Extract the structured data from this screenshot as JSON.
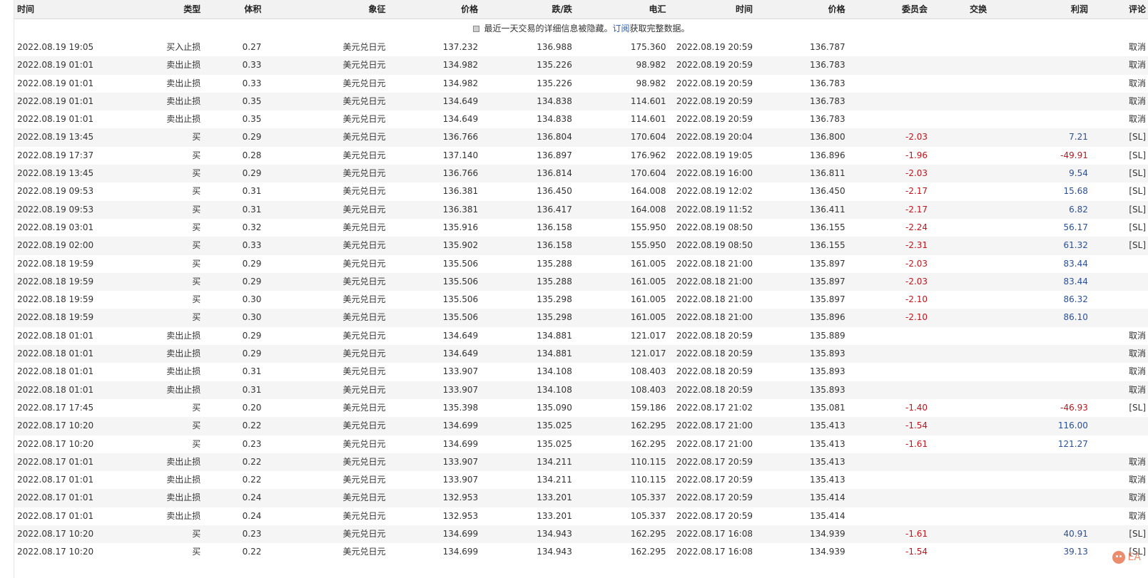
{
  "headers": {
    "open_time": "时间",
    "type": "类型",
    "volume": "体积",
    "symbol": "象征",
    "open_price": "价格",
    "sl": "跌/跌",
    "tp": "电汇",
    "close_time": "时间",
    "close_price": "价格",
    "commission": "委员会",
    "swap": "交换",
    "profit": "利润",
    "comment": "评论"
  },
  "notice": {
    "text_before": "最近一天交易的详细信息被隐藏。",
    "link": "订阅",
    "text_after": "获取完整数据。"
  },
  "watermark": "EA",
  "colors": {
    "negative": "#c0141c",
    "positive": "#2a4f9a",
    "header_bg": "#f2f2f2",
    "stripe_bg": "#f5f5f5"
  },
  "rows": [
    {
      "open_time": "2022.08.19 19:05",
      "type": "买入止损",
      "volume": "0.27",
      "symbol": "美元兑日元",
      "open_price": "137.232",
      "sl": "136.988",
      "tp": "175.360",
      "close_time": "2022.08.19 20:59",
      "close_price": "136.787",
      "commission": "",
      "commission_sign": "",
      "swap": "",
      "profit": "",
      "profit_sign": "",
      "comment": "取消"
    },
    {
      "open_time": "2022.08.19 01:01",
      "type": "卖出止损",
      "volume": "0.33",
      "symbol": "美元兑日元",
      "open_price": "134.982",
      "sl": "135.226",
      "tp": "98.982",
      "close_time": "2022.08.19 20:59",
      "close_price": "136.783",
      "commission": "",
      "commission_sign": "",
      "swap": "",
      "profit": "",
      "profit_sign": "",
      "comment": "取消"
    },
    {
      "open_time": "2022.08.19 01:01",
      "type": "卖出止损",
      "volume": "0.33",
      "symbol": "美元兑日元",
      "open_price": "134.982",
      "sl": "135.226",
      "tp": "98.982",
      "close_time": "2022.08.19 20:59",
      "close_price": "136.783",
      "commission": "",
      "commission_sign": "",
      "swap": "",
      "profit": "",
      "profit_sign": "",
      "comment": "取消"
    },
    {
      "open_time": "2022.08.19 01:01",
      "type": "卖出止损",
      "volume": "0.35",
      "symbol": "美元兑日元",
      "open_price": "134.649",
      "sl": "134.838",
      "tp": "114.601",
      "close_time": "2022.08.19 20:59",
      "close_price": "136.783",
      "commission": "",
      "commission_sign": "",
      "swap": "",
      "profit": "",
      "profit_sign": "",
      "comment": "取消"
    },
    {
      "open_time": "2022.08.19 01:01",
      "type": "卖出止损",
      "volume": "0.35",
      "symbol": "美元兑日元",
      "open_price": "134.649",
      "sl": "134.838",
      "tp": "114.601",
      "close_time": "2022.08.19 20:59",
      "close_price": "136.783",
      "commission": "",
      "commission_sign": "",
      "swap": "",
      "profit": "",
      "profit_sign": "",
      "comment": "取消"
    },
    {
      "open_time": "2022.08.19 13:45",
      "type": "买",
      "volume": "0.29",
      "symbol": "美元兑日元",
      "open_price": "136.766",
      "sl": "136.804",
      "tp": "170.604",
      "close_time": "2022.08.19 20:04",
      "close_price": "136.800",
      "commission": "-2.03",
      "commission_sign": "neg",
      "swap": "",
      "profit": "7.21",
      "profit_sign": "pos",
      "comment": "[SL]"
    },
    {
      "open_time": "2022.08.19 17:37",
      "type": "买",
      "volume": "0.28",
      "symbol": "美元兑日元",
      "open_price": "137.140",
      "sl": "136.897",
      "tp": "176.962",
      "close_time": "2022.08.19 19:05",
      "close_price": "136.896",
      "commission": "-1.96",
      "commission_sign": "neg",
      "swap": "",
      "profit": "-49.91",
      "profit_sign": "neg",
      "comment": "[SL]"
    },
    {
      "open_time": "2022.08.19 13:45",
      "type": "买",
      "volume": "0.29",
      "symbol": "美元兑日元",
      "open_price": "136.766",
      "sl": "136.814",
      "tp": "170.604",
      "close_time": "2022.08.19 16:00",
      "close_price": "136.811",
      "commission": "-2.03",
      "commission_sign": "neg",
      "swap": "",
      "profit": "9.54",
      "profit_sign": "pos",
      "comment": "[SL]"
    },
    {
      "open_time": "2022.08.19 09:53",
      "type": "买",
      "volume": "0.31",
      "symbol": "美元兑日元",
      "open_price": "136.381",
      "sl": "136.450",
      "tp": "164.008",
      "close_time": "2022.08.19 12:02",
      "close_price": "136.450",
      "commission": "-2.17",
      "commission_sign": "neg",
      "swap": "",
      "profit": "15.68",
      "profit_sign": "pos",
      "comment": "[SL]"
    },
    {
      "open_time": "2022.08.19 09:53",
      "type": "买",
      "volume": "0.31",
      "symbol": "美元兑日元",
      "open_price": "136.381",
      "sl": "136.417",
      "tp": "164.008",
      "close_time": "2022.08.19 11:52",
      "close_price": "136.411",
      "commission": "-2.17",
      "commission_sign": "neg",
      "swap": "",
      "profit": "6.82",
      "profit_sign": "pos",
      "comment": "[SL]"
    },
    {
      "open_time": "2022.08.19 03:01",
      "type": "买",
      "volume": "0.32",
      "symbol": "美元兑日元",
      "open_price": "135.916",
      "sl": "136.158",
      "tp": "155.950",
      "close_time": "2022.08.19 08:50",
      "close_price": "136.155",
      "commission": "-2.24",
      "commission_sign": "neg",
      "swap": "",
      "profit": "56.17",
      "profit_sign": "pos",
      "comment": "[SL]"
    },
    {
      "open_time": "2022.08.19 02:00",
      "type": "买",
      "volume": "0.33",
      "symbol": "美元兑日元",
      "open_price": "135.902",
      "sl": "136.158",
      "tp": "155.950",
      "close_time": "2022.08.19 08:50",
      "close_price": "136.155",
      "commission": "-2.31",
      "commission_sign": "neg",
      "swap": "",
      "profit": "61.32",
      "profit_sign": "pos",
      "comment": "[SL]"
    },
    {
      "open_time": "2022.08.18 19:59",
      "type": "买",
      "volume": "0.29",
      "symbol": "美元兑日元",
      "open_price": "135.506",
      "sl": "135.288",
      "tp": "161.005",
      "close_time": "2022.08.18 21:00",
      "close_price": "135.897",
      "commission": "-2.03",
      "commission_sign": "neg",
      "swap": "",
      "profit": "83.44",
      "profit_sign": "pos",
      "comment": ""
    },
    {
      "open_time": "2022.08.18 19:59",
      "type": "买",
      "volume": "0.29",
      "symbol": "美元兑日元",
      "open_price": "135.506",
      "sl": "135.288",
      "tp": "161.005",
      "close_time": "2022.08.18 21:00",
      "close_price": "135.897",
      "commission": "-2.03",
      "commission_sign": "neg",
      "swap": "",
      "profit": "83.44",
      "profit_sign": "pos",
      "comment": ""
    },
    {
      "open_time": "2022.08.18 19:59",
      "type": "买",
      "volume": "0.30",
      "symbol": "美元兑日元",
      "open_price": "135.506",
      "sl": "135.298",
      "tp": "161.005",
      "close_time": "2022.08.18 21:00",
      "close_price": "135.897",
      "commission": "-2.10",
      "commission_sign": "neg",
      "swap": "",
      "profit": "86.32",
      "profit_sign": "pos",
      "comment": ""
    },
    {
      "open_time": "2022.08.18 19:59",
      "type": "买",
      "volume": "0.30",
      "symbol": "美元兑日元",
      "open_price": "135.506",
      "sl": "135.298",
      "tp": "161.005",
      "close_time": "2022.08.18 21:00",
      "close_price": "135.896",
      "commission": "-2.10",
      "commission_sign": "neg",
      "swap": "",
      "profit": "86.10",
      "profit_sign": "pos",
      "comment": ""
    },
    {
      "open_time": "2022.08.18 01:01",
      "type": "卖出止损",
      "volume": "0.29",
      "symbol": "美元兑日元",
      "open_price": "134.649",
      "sl": "134.881",
      "tp": "121.017",
      "close_time": "2022.08.18 20:59",
      "close_price": "135.889",
      "commission": "",
      "commission_sign": "",
      "swap": "",
      "profit": "",
      "profit_sign": "",
      "comment": "取消"
    },
    {
      "open_time": "2022.08.18 01:01",
      "type": "卖出止损",
      "volume": "0.29",
      "symbol": "美元兑日元",
      "open_price": "134.649",
      "sl": "134.881",
      "tp": "121.017",
      "close_time": "2022.08.18 20:59",
      "close_price": "135.893",
      "commission": "",
      "commission_sign": "",
      "swap": "",
      "profit": "",
      "profit_sign": "",
      "comment": "取消"
    },
    {
      "open_time": "2022.08.18 01:01",
      "type": "卖出止损",
      "volume": "0.31",
      "symbol": "美元兑日元",
      "open_price": "133.907",
      "sl": "134.108",
      "tp": "108.403",
      "close_time": "2022.08.18 20:59",
      "close_price": "135.893",
      "commission": "",
      "commission_sign": "",
      "swap": "",
      "profit": "",
      "profit_sign": "",
      "comment": "取消"
    },
    {
      "open_time": "2022.08.18 01:01",
      "type": "卖出止损",
      "volume": "0.31",
      "symbol": "美元兑日元",
      "open_price": "133.907",
      "sl": "134.108",
      "tp": "108.403",
      "close_time": "2022.08.18 20:59",
      "close_price": "135.893",
      "commission": "",
      "commission_sign": "",
      "swap": "",
      "profit": "",
      "profit_sign": "",
      "comment": "取消"
    },
    {
      "open_time": "2022.08.17 17:45",
      "type": "买",
      "volume": "0.20",
      "symbol": "美元兑日元",
      "open_price": "135.398",
      "sl": "135.090",
      "tp": "159.186",
      "close_time": "2022.08.17 21:02",
      "close_price": "135.081",
      "commission": "-1.40",
      "commission_sign": "neg",
      "swap": "",
      "profit": "-46.93",
      "profit_sign": "neg",
      "comment": "[SL]"
    },
    {
      "open_time": "2022.08.17 10:20",
      "type": "买",
      "volume": "0.22",
      "symbol": "美元兑日元",
      "open_price": "134.699",
      "sl": "135.025",
      "tp": "162.295",
      "close_time": "2022.08.17 21:00",
      "close_price": "135.413",
      "commission": "-1.54",
      "commission_sign": "neg",
      "swap": "",
      "profit": "116.00",
      "profit_sign": "pos",
      "comment": ""
    },
    {
      "open_time": "2022.08.17 10:20",
      "type": "买",
      "volume": "0.23",
      "symbol": "美元兑日元",
      "open_price": "134.699",
      "sl": "135.025",
      "tp": "162.295",
      "close_time": "2022.08.17 21:00",
      "close_price": "135.413",
      "commission": "-1.61",
      "commission_sign": "neg",
      "swap": "",
      "profit": "121.27",
      "profit_sign": "pos",
      "comment": ""
    },
    {
      "open_time": "2022.08.17 01:01",
      "type": "卖出止损",
      "volume": "0.22",
      "symbol": "美元兑日元",
      "open_price": "133.907",
      "sl": "134.211",
      "tp": "110.115",
      "close_time": "2022.08.17 20:59",
      "close_price": "135.413",
      "commission": "",
      "commission_sign": "",
      "swap": "",
      "profit": "",
      "profit_sign": "",
      "comment": "取消"
    },
    {
      "open_time": "2022.08.17 01:01",
      "type": "卖出止损",
      "volume": "0.22",
      "symbol": "美元兑日元",
      "open_price": "133.907",
      "sl": "134.211",
      "tp": "110.115",
      "close_time": "2022.08.17 20:59",
      "close_price": "135.413",
      "commission": "",
      "commission_sign": "",
      "swap": "",
      "profit": "",
      "profit_sign": "",
      "comment": "取消"
    },
    {
      "open_time": "2022.08.17 01:01",
      "type": "卖出止损",
      "volume": "0.24",
      "symbol": "美元兑日元",
      "open_price": "132.953",
      "sl": "133.201",
      "tp": "105.337",
      "close_time": "2022.08.17 20:59",
      "close_price": "135.414",
      "commission": "",
      "commission_sign": "",
      "swap": "",
      "profit": "",
      "profit_sign": "",
      "comment": "取消"
    },
    {
      "open_time": "2022.08.17 01:01",
      "type": "卖出止损",
      "volume": "0.24",
      "symbol": "美元兑日元",
      "open_price": "132.953",
      "sl": "133.201",
      "tp": "105.337",
      "close_time": "2022.08.17 20:59",
      "close_price": "135.414",
      "commission": "",
      "commission_sign": "",
      "swap": "",
      "profit": "",
      "profit_sign": "",
      "comment": "取消"
    },
    {
      "open_time": "2022.08.17 10:20",
      "type": "买",
      "volume": "0.23",
      "symbol": "美元兑日元",
      "open_price": "134.699",
      "sl": "134.943",
      "tp": "162.295",
      "close_time": "2022.08.17 16:08",
      "close_price": "134.939",
      "commission": "-1.61",
      "commission_sign": "neg",
      "swap": "",
      "profit": "40.91",
      "profit_sign": "pos",
      "comment": "[SL]"
    },
    {
      "open_time": "2022.08.17 10:20",
      "type": "买",
      "volume": "0.22",
      "symbol": "美元兑日元",
      "open_price": "134.699",
      "sl": "134.943",
      "tp": "162.295",
      "close_time": "2022.08.17 16:08",
      "close_price": "134.939",
      "commission": "-1.54",
      "commission_sign": "neg",
      "swap": "",
      "profit": "39.13",
      "profit_sign": "pos",
      "comment": "[SL]"
    }
  ]
}
